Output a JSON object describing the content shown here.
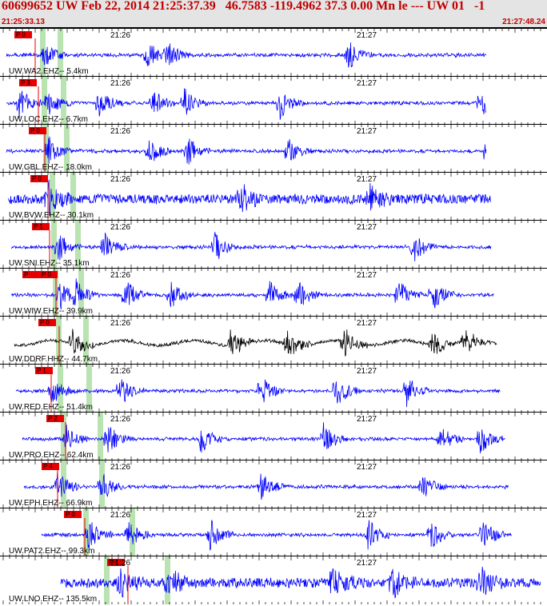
{
  "header": {
    "title": "60699652 UW Feb 22, 2014 21:25:37.39   46.7583 -119.4962 37.3 0.00 Mn le --- UW 01   -1",
    "start_time": "21:25:33.13",
    "end_time": "21:27:48.24"
  },
  "time_ticks": [
    "21:26",
    "21:27"
  ],
  "colors": {
    "header_bg": "#e4e4e4",
    "header_text": "#c00000",
    "trace_blue": "#0000ff",
    "trace_black": "#000000",
    "pick_red": "#e80000",
    "window_green": "#b9e3b0"
  },
  "traces": [
    {
      "label": "UW.WA2.EHZ-- 5.4km",
      "picks": [
        "P 0"
      ],
      "color": "blue"
    },
    {
      "label": "UW.LOC.EHZ-- 6.7km",
      "picks": [
        "P 3"
      ],
      "color": "blue"
    },
    {
      "label": "UW.GBL.EHZ-- 18.0km",
      "picks": [
        "P 0"
      ],
      "color": "blue"
    },
    {
      "label": "UW.BVW.EHZ-- 30.1km",
      "picks": [
        "P 0"
      ],
      "color": "blue"
    },
    {
      "label": "UW.SNI.EHZ-- 35.1km",
      "picks": [
        "P 1"
      ],
      "color": "blue"
    },
    {
      "label": "UW.WIW.EHZ-- 39.9km",
      "picks": [
        "P",
        "P 0"
      ],
      "color": "blue"
    },
    {
      "label": "UW.DDRF.HHZ-- 44.7km",
      "picks": [
        "P 0"
      ],
      "color": "black"
    },
    {
      "label": "UW.RED.EHZ-- 51.4km",
      "picks": [
        "P 1"
      ],
      "color": "blue"
    },
    {
      "label": "UW.PRO.EHZ-- 62.4km",
      "picks": [
        "P 2"
      ],
      "color": "blue"
    },
    {
      "label": "UW.EPH.EHZ-- 66.9km",
      "picks": [
        "P 4"
      ],
      "color": "blue"
    },
    {
      "label": "UW.PAT2.EHZ-- 99.3km",
      "picks": [
        "P 0"
      ],
      "color": "blue"
    },
    {
      "label": "UW.LNO.EHZ-- 135.5km",
      "picks": [
        "P 4"
      ],
      "color": "blue"
    }
  ]
}
